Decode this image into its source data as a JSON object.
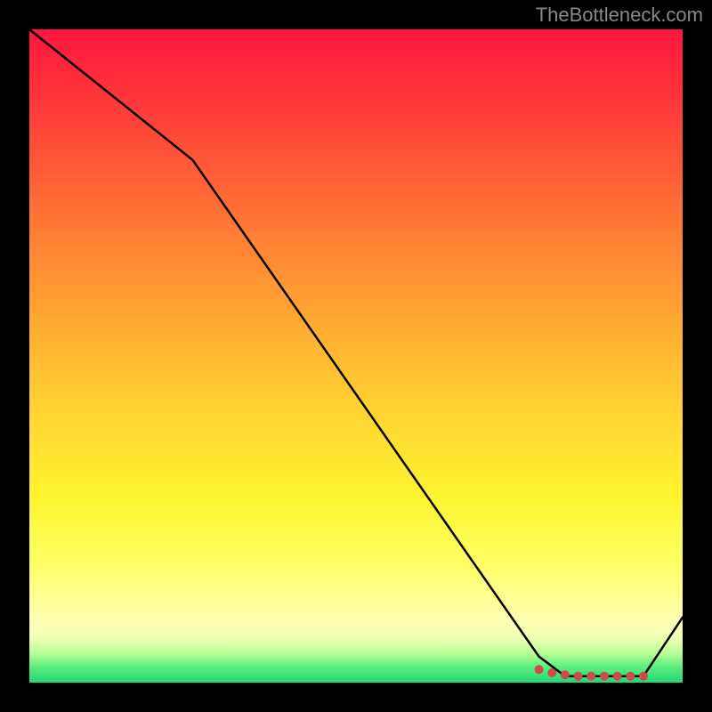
{
  "attribution": "TheBottleneck.com",
  "chart_data": {
    "type": "line",
    "title": "",
    "xlabel": "",
    "ylabel": "",
    "xlim": [
      0,
      100
    ],
    "ylim": [
      0,
      100
    ],
    "series": [
      {
        "name": "curve",
        "x": [
          0,
          25,
          78,
          82,
          90,
          94,
          100
        ],
        "values": [
          100,
          80,
          4,
          1,
          1,
          1,
          10
        ]
      }
    ],
    "markers": {
      "name": "bottom-cluster",
      "color": "#d14a4a",
      "points": [
        {
          "x": 78,
          "y": 2
        },
        {
          "x": 80,
          "y": 1.5
        },
        {
          "x": 82,
          "y": 1.2
        },
        {
          "x": 84,
          "y": 1
        },
        {
          "x": 86,
          "y": 1
        },
        {
          "x": 88,
          "y": 1
        },
        {
          "x": 90,
          "y": 1
        },
        {
          "x": 92,
          "y": 1
        },
        {
          "x": 94,
          "y": 1
        }
      ]
    },
    "gradient_stops": [
      {
        "pos": 0,
        "color": "#ff163f"
      },
      {
        "pos": 0.35,
        "color": "#ff8a33"
      },
      {
        "pos": 0.72,
        "color": "#fff531"
      },
      {
        "pos": 0.93,
        "color": "#f3ffb5"
      },
      {
        "pos": 1.0,
        "color": "#1fd873"
      }
    ]
  }
}
